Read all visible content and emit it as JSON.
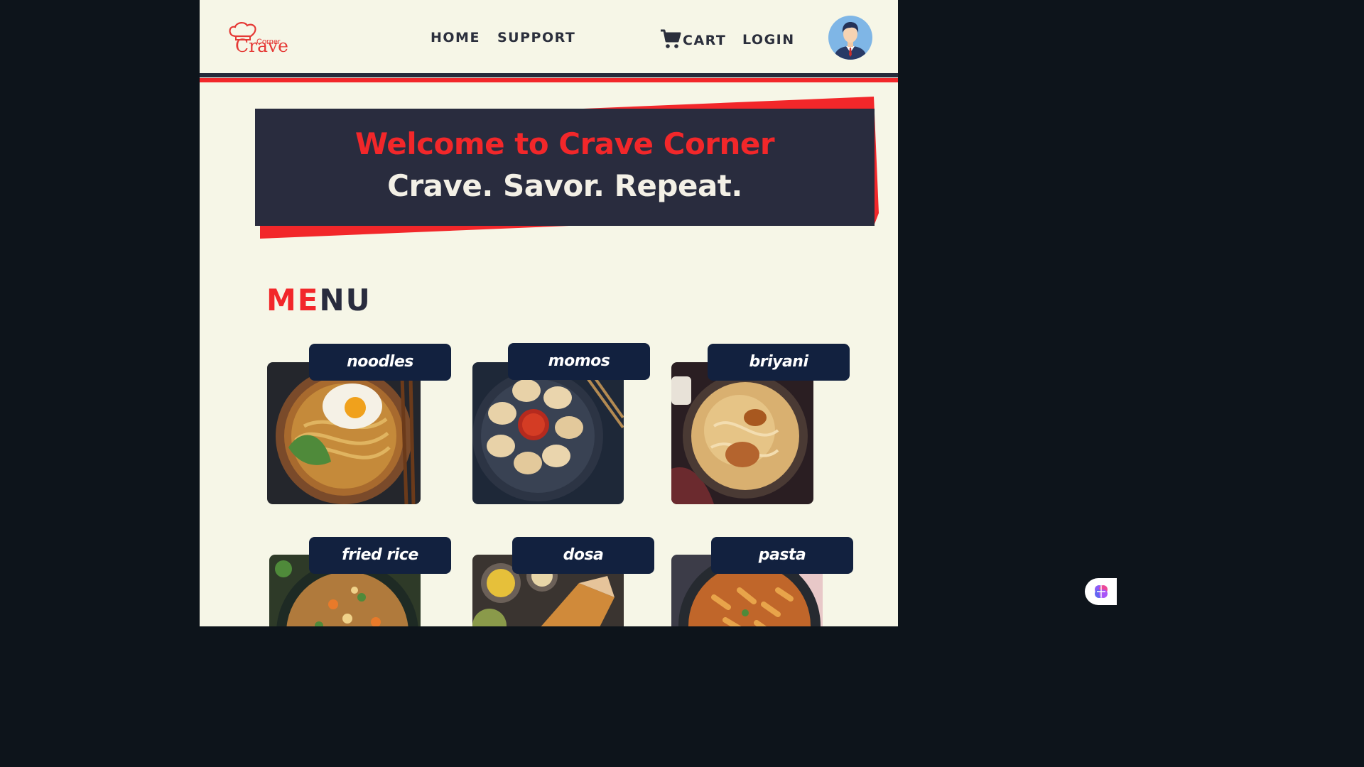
{
  "brand": {
    "word": "Crave",
    "sub": "Corner"
  },
  "nav": {
    "home": "HOME",
    "support": "SUPPORT",
    "cart": "CART",
    "login": "LOGIN"
  },
  "hero": {
    "title": "Welcome to Crave Corner",
    "tagline": "Crave. Savor. Repeat."
  },
  "menu": {
    "title_a": "ME",
    "title_b": "NU",
    "items": [
      {
        "name": "noodles"
      },
      {
        "name": "momos"
      },
      {
        "name": "briyani"
      },
      {
        "name": "fried rice"
      },
      {
        "name": "dosa"
      },
      {
        "name": "pasta"
      }
    ]
  },
  "colors": {
    "accent": "#f2272a",
    "dark": "#292c3e",
    "tag": "#12213f",
    "page": "#f6f6e7"
  },
  "icons": {
    "cart": "cart-icon",
    "avatar": "user-avatar",
    "assistant": "brain-icon"
  }
}
